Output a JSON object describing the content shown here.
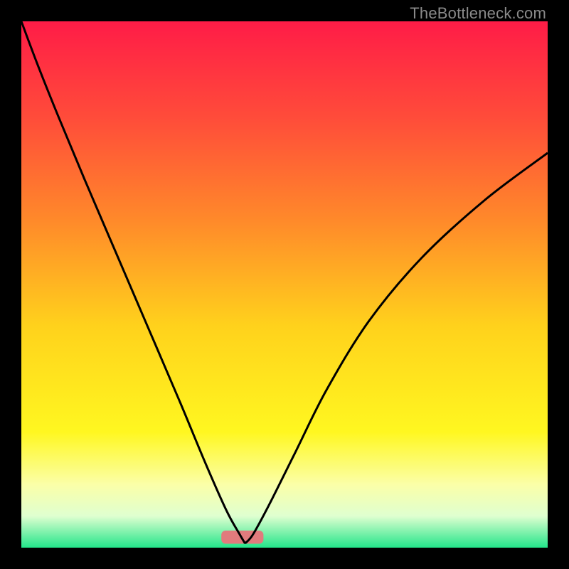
{
  "watermark": {
    "text": "TheBottleneck.com"
  },
  "chart_data": {
    "type": "line",
    "title": "",
    "xlabel": "",
    "ylabel": "",
    "xlim": [
      0,
      100
    ],
    "ylim": [
      0,
      100
    ],
    "grid": false,
    "legend": false,
    "background_gradient": {
      "stops": [
        {
          "pos": 0.0,
          "color": "#ff1c47"
        },
        {
          "pos": 0.18,
          "color": "#ff4b3a"
        },
        {
          "pos": 0.38,
          "color": "#ff8a2a"
        },
        {
          "pos": 0.58,
          "color": "#ffd21c"
        },
        {
          "pos": 0.78,
          "color": "#fff720"
        },
        {
          "pos": 0.88,
          "color": "#fbffa8"
        },
        {
          "pos": 0.94,
          "color": "#dfffd0"
        },
        {
          "pos": 1.0,
          "color": "#23e58a"
        }
      ]
    },
    "bottom_bar": {
      "color": "#e17b7d",
      "x0": 38,
      "x1": 46,
      "y": 2,
      "height": 2.5
    },
    "series": [
      {
        "name": "bottleneck-curve-left",
        "x": [
          0,
          3,
          7,
          12,
          18,
          24,
          30,
          35,
          39,
          41.5,
          42.5
        ],
        "y": [
          100,
          92,
          82,
          70,
          56,
          42,
          28,
          16,
          7,
          2.5,
          0.8
        ]
      },
      {
        "name": "bottleneck-curve-right",
        "x": [
          42.5,
          44,
          47,
          52,
          58,
          66,
          76,
          88,
          100
        ],
        "y": [
          0.8,
          2.5,
          8,
          18,
          30,
          43,
          55,
          66,
          75
        ]
      }
    ],
    "annotations": []
  }
}
